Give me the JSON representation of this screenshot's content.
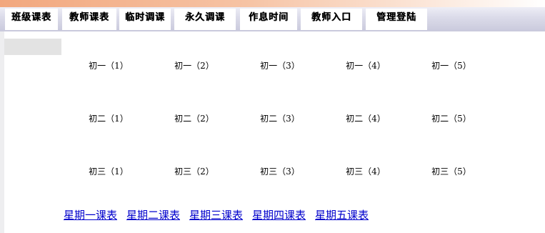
{
  "nav": {
    "items": [
      {
        "label": "班级课表"
      },
      {
        "label": "教师课表"
      },
      {
        "label": "临时调课"
      },
      {
        "label": "永久调课"
      },
      {
        "label": "作息时间"
      },
      {
        "label": "教师入口"
      },
      {
        "label": "管理登陆"
      }
    ]
  },
  "classes": {
    "rows": [
      {
        "items": [
          "初一（1）",
          "初一（2）",
          "初一（3）",
          "初一（4）",
          "初一（5）"
        ]
      },
      {
        "items": [
          "初二（1）",
          "初二（2）",
          "初二（3）",
          "初二（4）",
          "初二（5）"
        ]
      },
      {
        "items": [
          "初三（1）",
          "初三（2）",
          "初三（3）",
          "初三（4）",
          "初三（5）"
        ]
      }
    ]
  },
  "weekdays": {
    "links": [
      "星期一课表",
      "星期二课表",
      "星期三课表",
      "星期四课表",
      "星期五课表"
    ]
  },
  "colors": {
    "banner": "#f2a77e",
    "navbar": "#d4d4e6",
    "link": "#0000cc"
  }
}
